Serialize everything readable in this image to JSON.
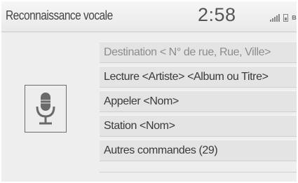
{
  "header": {
    "title": "Reconnaissance vocale",
    "clock": "2:58",
    "status_icons": [
      "signal-icon",
      "battery-icon",
      "bluetooth-icon"
    ]
  },
  "mic_icon": "microphone-icon",
  "menu": {
    "items": [
      {
        "label": "Destination < N° de rue, Rue, Ville>"
      },
      {
        "label": "Lecture <Artiste> <Album ou Titre>"
      },
      {
        "label": "Appeler <Nom>"
      },
      {
        "label": "Station <Nom>"
      },
      {
        "label": "Autres commandes (29)"
      }
    ]
  },
  "colors": {
    "background": "#eeeeee",
    "menu_item": "#e4e4e4",
    "text": "#3a3a3a",
    "text_dim": "#8c8c8c"
  }
}
